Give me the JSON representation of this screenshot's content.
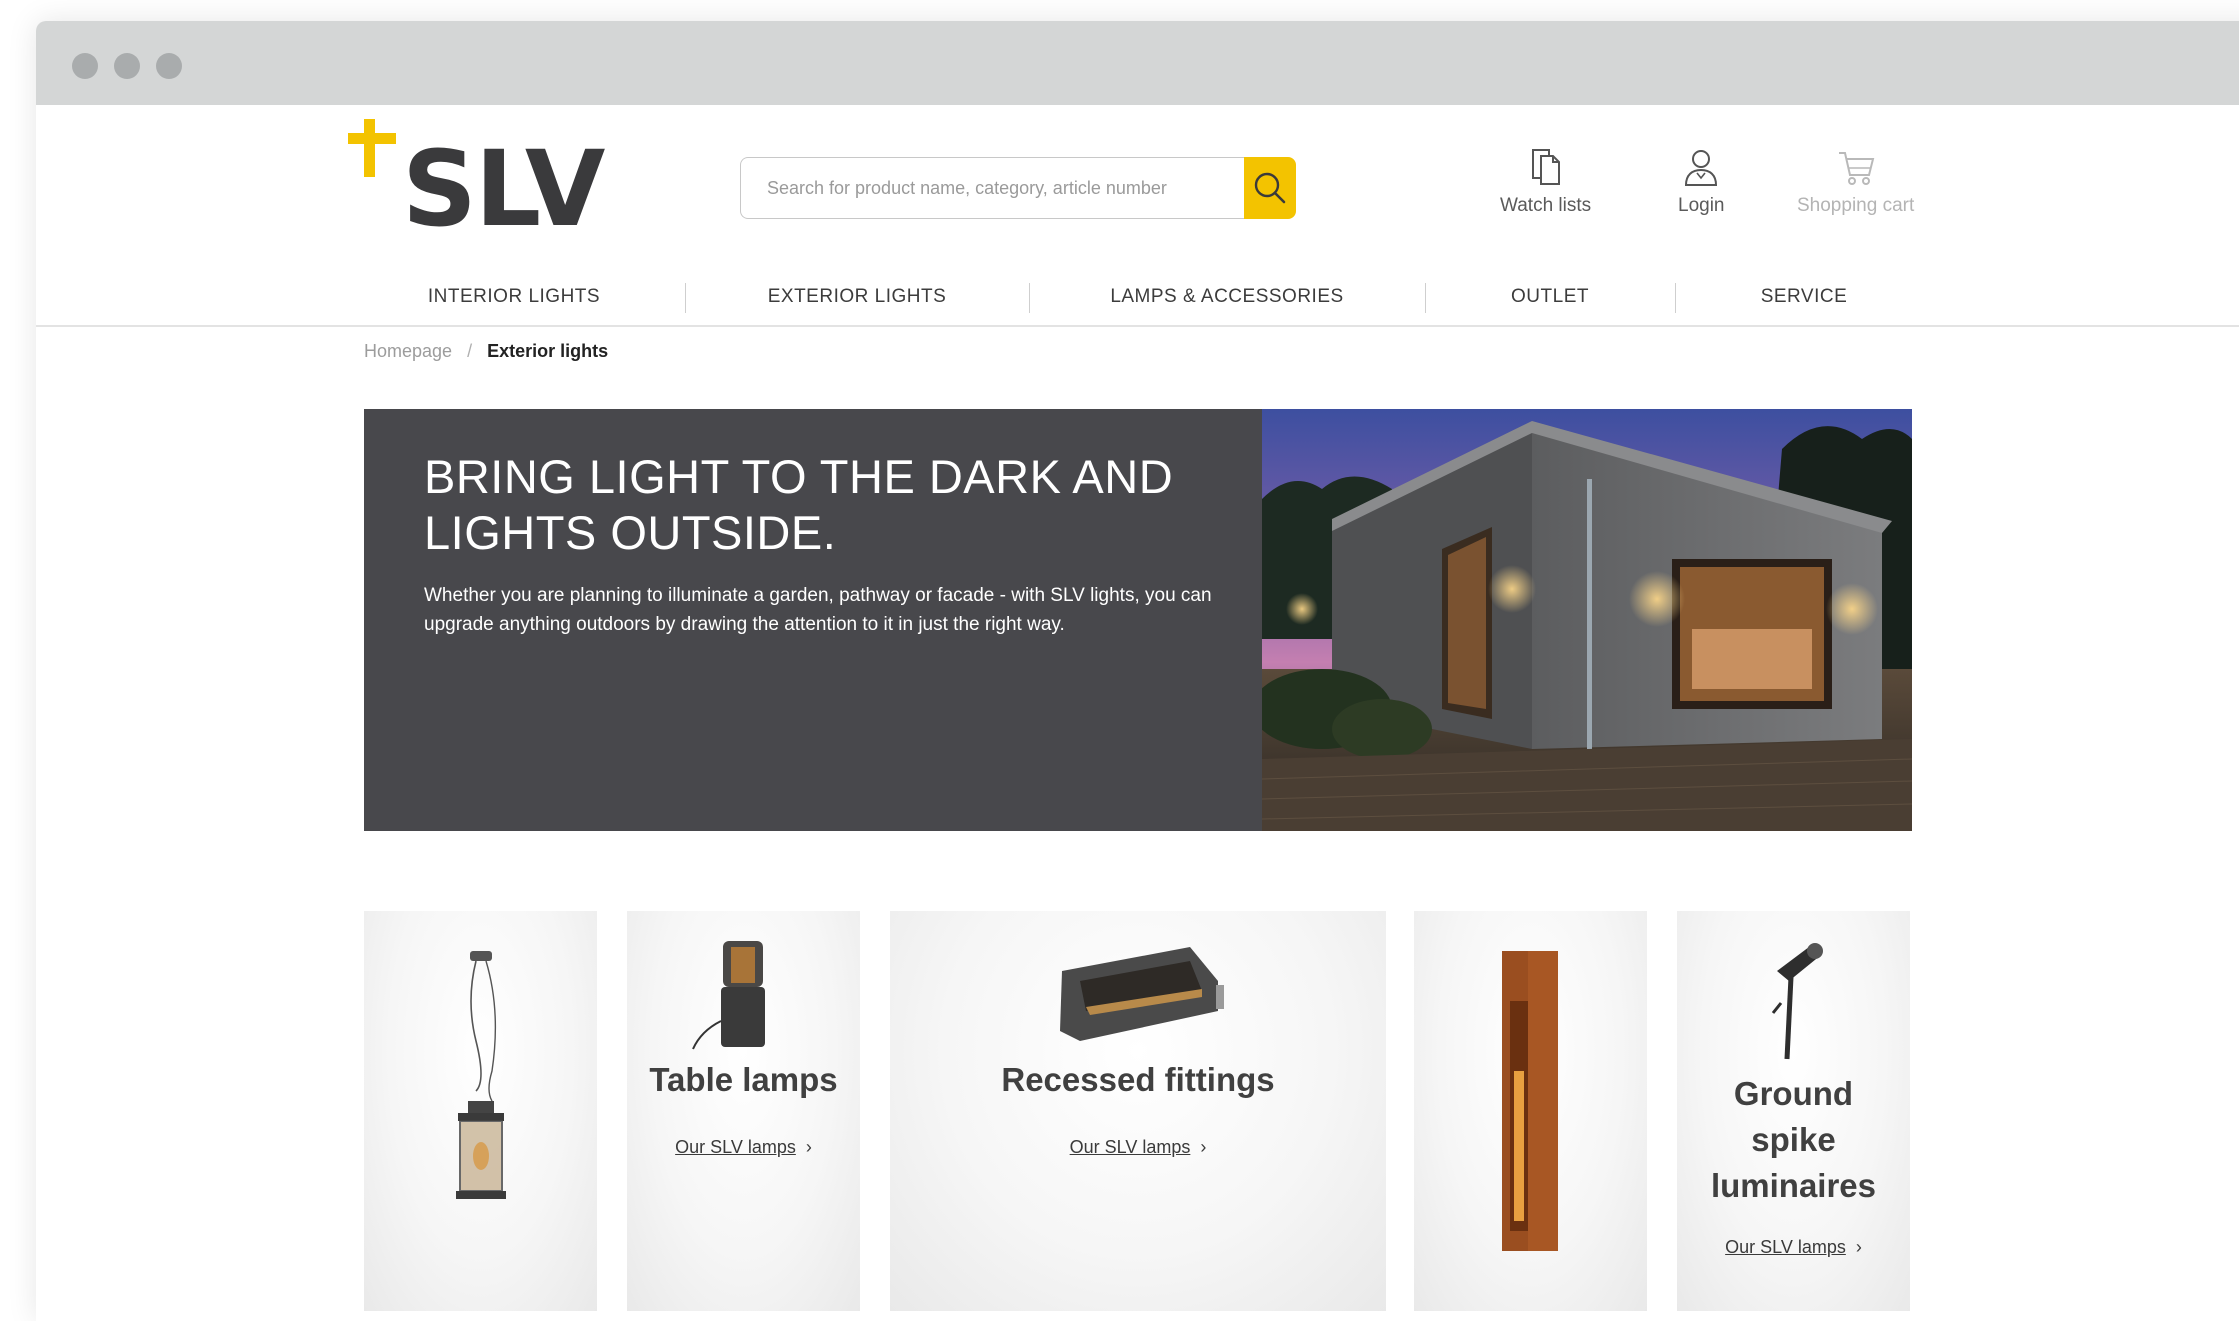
{
  "header": {
    "search_placeholder": "Search for product name, category, article number",
    "actions": [
      {
        "label": "Watch lists",
        "icon": "watchlist-icon"
      },
      {
        "label": "Login",
        "icon": "user-icon"
      },
      {
        "label": "Shopping cart",
        "icon": "cart-icon"
      }
    ]
  },
  "nav": {
    "items": [
      "INTERIOR LIGHTS",
      "EXTERIOR LIGHTS",
      "LAMPS & ACCESSORIES",
      "OUTLET",
      "SERVICE"
    ]
  },
  "breadcrumb": {
    "home": "Homepage",
    "separator": "/",
    "current": "Exterior lights"
  },
  "hero": {
    "title": "BRING LIGHT TO THE DARK AND LIGHTS OUTSIDE.",
    "description": "Whether you are planning to illuminate a garden, pathway or facade - with SLV lights, you can upgrade anything outdoors by drawing the attention to it in just the right way."
  },
  "categories": [
    {
      "title": "",
      "link": "",
      "icon": "pendant-lamp-icon"
    },
    {
      "title": "Table lamps",
      "link": "Our SLV lamps",
      "icon": "table-lamp-icon"
    },
    {
      "title": "Recessed fittings",
      "link": "Our SLV lamps",
      "icon": "recessed-fitting-icon"
    },
    {
      "title": "",
      "link": "",
      "icon": "bollard-light-icon"
    },
    {
      "title": "Ground spike luminaires",
      "link": "Our SLV lamps",
      "icon": "ground-spike-icon"
    }
  ],
  "colors": {
    "brand_yellow": "#f3c300",
    "logo_dark": "#3a3a3c",
    "hero_bg": "#48484c"
  }
}
